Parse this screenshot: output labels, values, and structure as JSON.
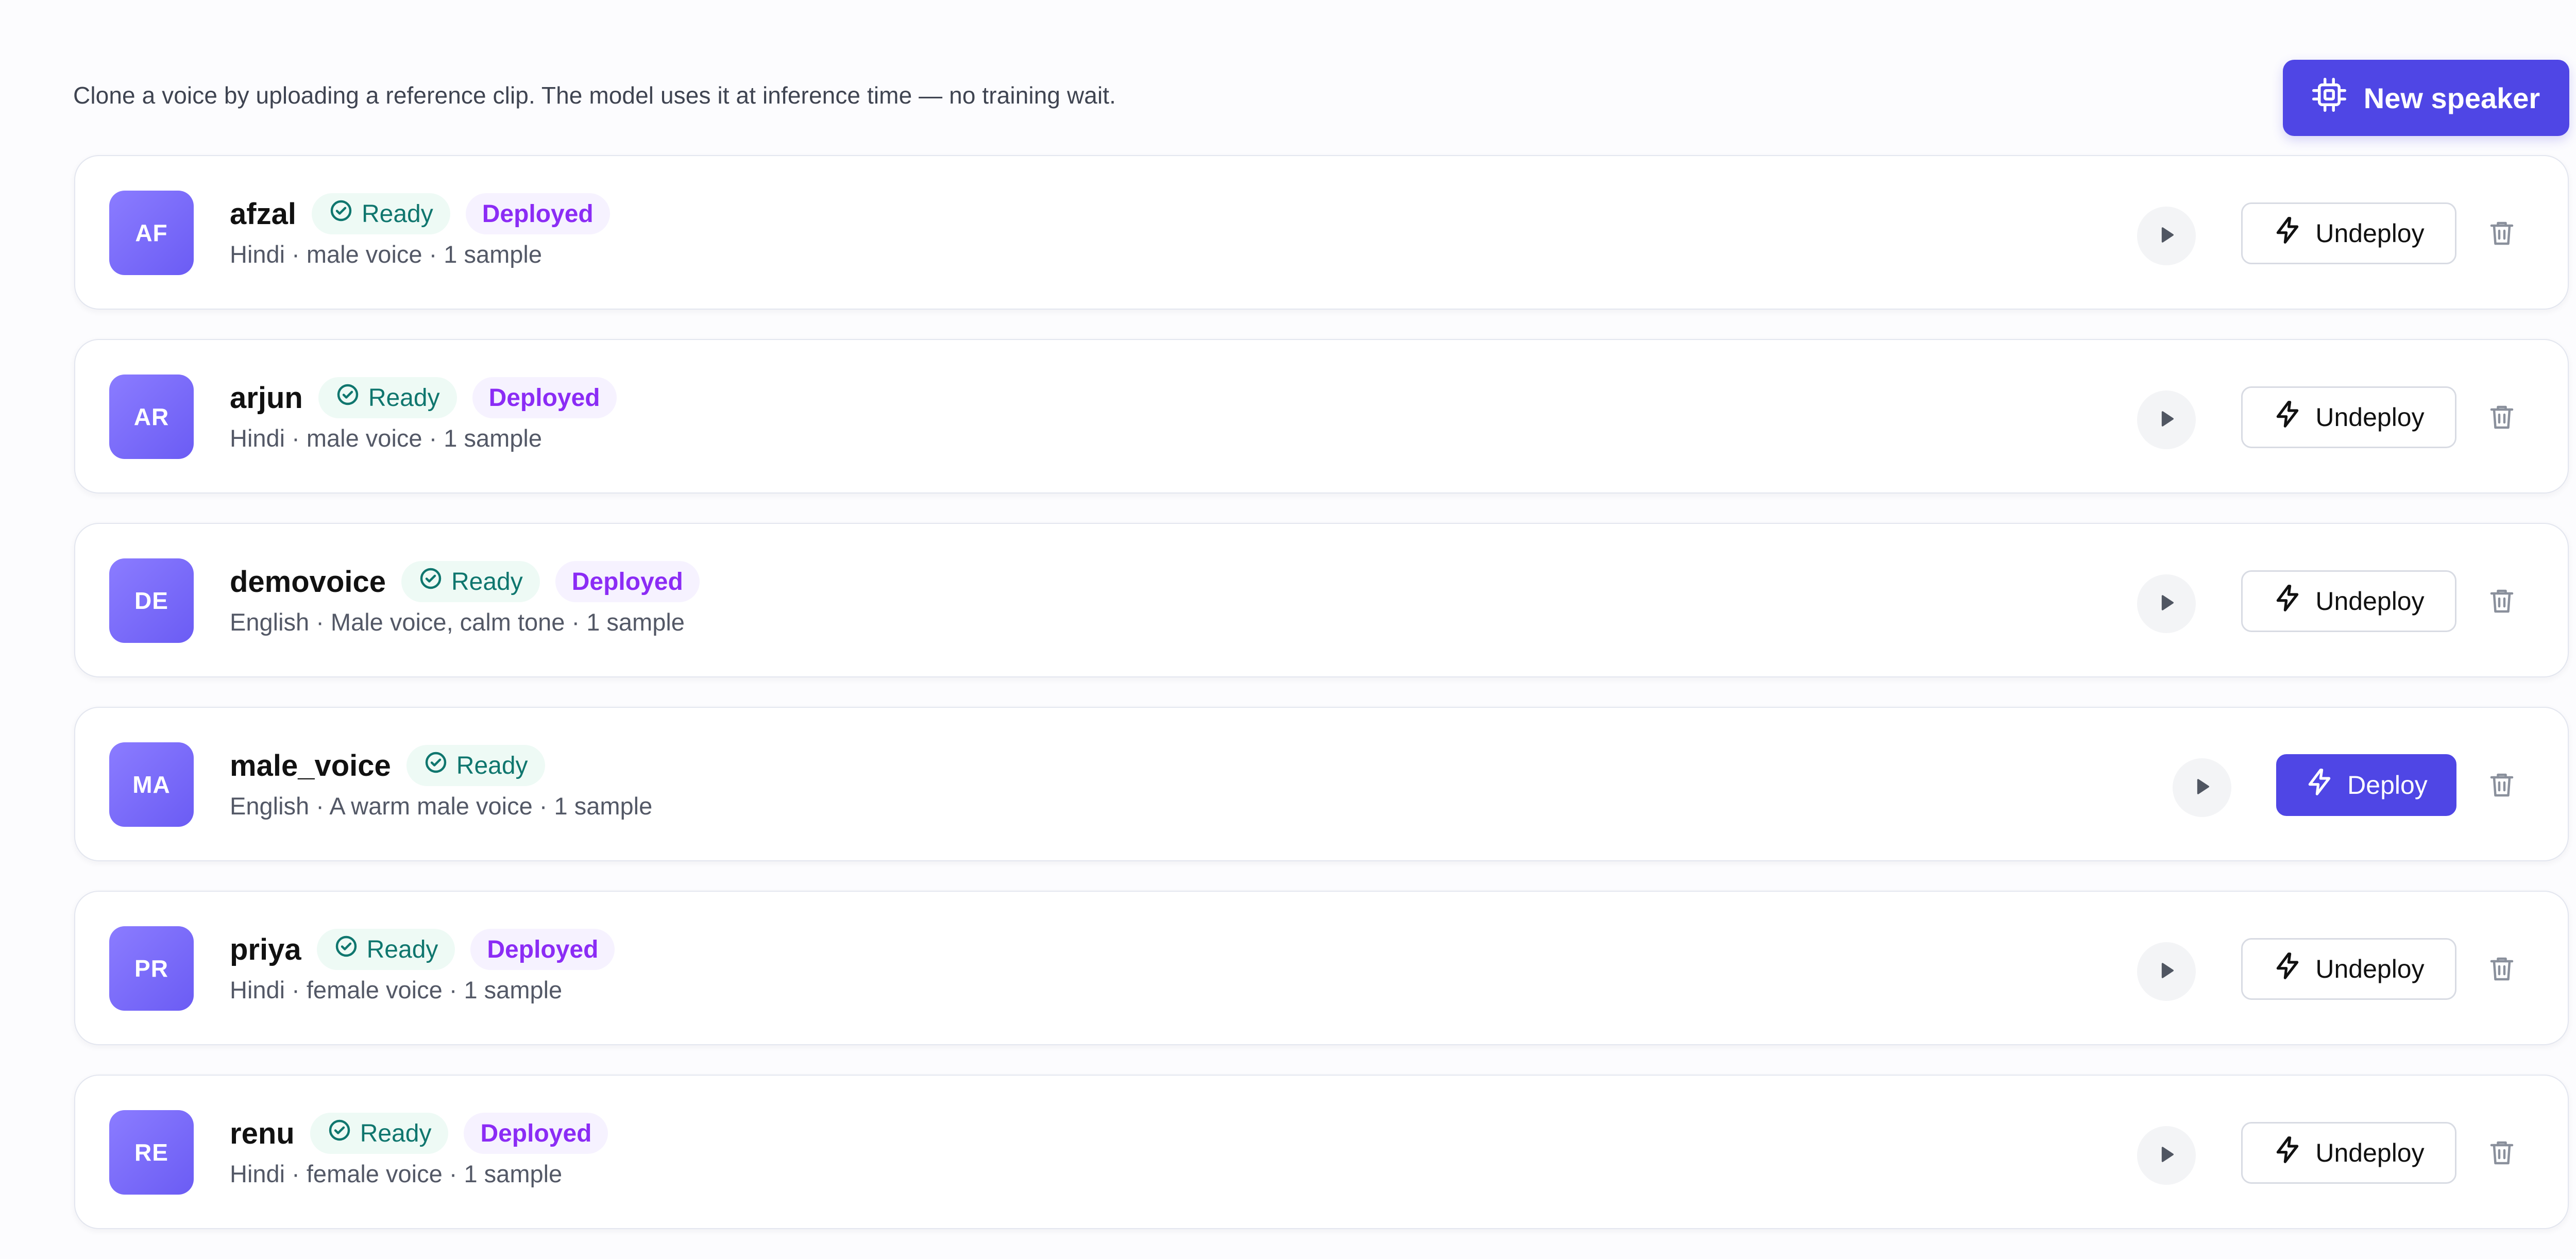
{
  "header": {
    "subtitle": "Clone a voice by uploading a reference clip. The model uses it at inference time — no training wait.",
    "new_speaker_label": "New speaker",
    "new_speaker_icon": "chip-icon"
  },
  "speakers": [
    {
      "initials": "AF",
      "name": "afzal",
      "status": "Ready",
      "deployed_label": "Deployed",
      "meta": "Hindi · male voice · 1 sample",
      "action_label": "Undeploy"
    },
    {
      "initials": "AR",
      "name": "arjun",
      "status": "Ready",
      "deployed_label": "Deployed",
      "meta": "Hindi · male voice · 1 sample",
      "action_label": "Undeploy"
    },
    {
      "initials": "DE",
      "name": "demovoice",
      "status": "Ready",
      "deployed_label": "Deployed",
      "meta": "English · Male voice, calm tone · 1 sample",
      "action_label": "Undeploy"
    },
    {
      "initials": "MA",
      "name": "male_voice",
      "status": "Ready",
      "meta": "English · A warm male voice · 1 sample",
      "action_label": "Deploy"
    },
    {
      "initials": "PR",
      "name": "priya",
      "status": "Ready",
      "deployed_label": "Deployed",
      "meta": "Hindi · female voice · 1 sample",
      "action_label": "Undeploy"
    },
    {
      "initials": "RE",
      "name": "renu",
      "status": "Ready",
      "deployed_label": "Deployed",
      "meta": "Hindi · female voice · 1 sample",
      "action_label": "Undeploy"
    }
  ],
  "colors": {
    "primary": "#4f46e5",
    "ready_text": "#0f766e",
    "ready_bg": "#eefaf5",
    "deployed_text": "#8b2cf5",
    "deployed_bg": "#f6f2ff",
    "avatar_start": "#8b7cff",
    "avatar_end": "#6b5cf4"
  },
  "icons": {
    "play": "play-icon",
    "action": "lightning-icon",
    "delete": "trash-icon",
    "status": "check-circle-icon"
  }
}
